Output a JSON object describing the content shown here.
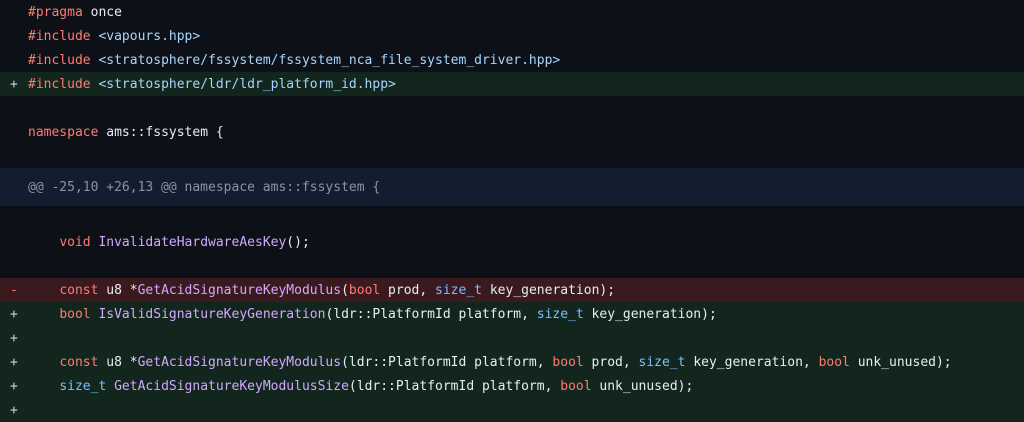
{
  "diff": {
    "lines": [
      {
        "kind": "ctx",
        "marker": "",
        "tokens": [
          {
            "t": "#pragma",
            "c": "kw"
          },
          {
            "t": " once",
            "c": "plain"
          }
        ]
      },
      {
        "kind": "ctx",
        "marker": "",
        "tokens": [
          {
            "t": "#include",
            "c": "kw"
          },
          {
            "t": " ",
            "c": "plain"
          },
          {
            "t": "<vapours.hpp>",
            "c": "str"
          }
        ]
      },
      {
        "kind": "ctx",
        "marker": "",
        "tokens": [
          {
            "t": "#include",
            "c": "kw"
          },
          {
            "t": " ",
            "c": "plain"
          },
          {
            "t": "<stratosphere/fssystem/fssystem_nca_file_system_driver.hpp>",
            "c": "str"
          }
        ]
      },
      {
        "kind": "add",
        "marker": "+",
        "tokens": [
          {
            "t": "#include",
            "c": "kw"
          },
          {
            "t": " ",
            "c": "plain"
          },
          {
            "t": "<stratosphere/ldr/ldr_platform_id.hpp>",
            "c": "str"
          }
        ]
      },
      {
        "kind": "ctx",
        "marker": "",
        "tokens": []
      },
      {
        "kind": "ctx",
        "marker": "",
        "tokens": [
          {
            "t": "namespace",
            "c": "kw"
          },
          {
            "t": " ams::fssystem {",
            "c": "plain"
          }
        ]
      },
      {
        "kind": "ctx",
        "marker": "",
        "tokens": []
      },
      {
        "kind": "hunk",
        "marker": "",
        "tokens": [
          {
            "t": "@@ -25,10 +26,13 @@ namespace ams::fssystem {",
            "c": "hunk"
          }
        ]
      },
      {
        "kind": "ctx",
        "marker": "",
        "tokens": []
      },
      {
        "kind": "ctx",
        "marker": "",
        "tokens": [
          {
            "t": "    ",
            "c": "plain"
          },
          {
            "t": "void",
            "c": "kw"
          },
          {
            "t": " ",
            "c": "plain"
          },
          {
            "t": "InvalidateHardwareAesKey",
            "c": "fn"
          },
          {
            "t": "();",
            "c": "plain"
          }
        ]
      },
      {
        "kind": "ctx",
        "marker": "",
        "tokens": []
      },
      {
        "kind": "del",
        "marker": "-",
        "tokens": [
          {
            "t": "    ",
            "c": "plain"
          },
          {
            "t": "const",
            "c": "kw"
          },
          {
            "t": " u8 *",
            "c": "plain"
          },
          {
            "t": "GetAcidSignatureKeyModulus",
            "c": "fn"
          },
          {
            "t": "(",
            "c": "plain"
          },
          {
            "t": "bool",
            "c": "kw"
          },
          {
            "t": " prod, ",
            "c": "plain"
          },
          {
            "t": "size_t",
            "c": "type"
          },
          {
            "t": " key_generation);",
            "c": "plain"
          }
        ]
      },
      {
        "kind": "add",
        "marker": "+",
        "tokens": [
          {
            "t": "    ",
            "c": "plain"
          },
          {
            "t": "bool",
            "c": "kw"
          },
          {
            "t": " ",
            "c": "plain"
          },
          {
            "t": "IsValidSignatureKeyGeneration",
            "c": "fn"
          },
          {
            "t": "(ldr::PlatformId platform, ",
            "c": "plain"
          },
          {
            "t": "size_t",
            "c": "type"
          },
          {
            "t": " key_generation);",
            "c": "plain"
          }
        ]
      },
      {
        "kind": "add",
        "marker": "+",
        "tokens": []
      },
      {
        "kind": "add",
        "marker": "+",
        "tokens": [
          {
            "t": "    ",
            "c": "plain"
          },
          {
            "t": "const",
            "c": "kw"
          },
          {
            "t": " u8 *",
            "c": "plain"
          },
          {
            "t": "GetAcidSignatureKeyModulus",
            "c": "fn"
          },
          {
            "t": "(ldr::PlatformId platform, ",
            "c": "plain"
          },
          {
            "t": "bool",
            "c": "kw"
          },
          {
            "t": " prod, ",
            "c": "plain"
          },
          {
            "t": "size_t",
            "c": "type"
          },
          {
            "t": " key_generation, ",
            "c": "plain"
          },
          {
            "t": "bool",
            "c": "kw"
          },
          {
            "t": " unk_unused);",
            "c": "plain"
          }
        ]
      },
      {
        "kind": "add",
        "marker": "+",
        "tokens": [
          {
            "t": "    ",
            "c": "plain"
          },
          {
            "t": "size_t",
            "c": "type"
          },
          {
            "t": " ",
            "c": "plain"
          },
          {
            "t": "GetAcidSignatureKeyModulusSize",
            "c": "fn"
          },
          {
            "t": "(ldr::PlatformId platform, ",
            "c": "plain"
          },
          {
            "t": "bool",
            "c": "kw"
          },
          {
            "t": " unk_unused);",
            "c": "plain"
          }
        ]
      },
      {
        "kind": "add",
        "marker": "+",
        "tokens": []
      }
    ]
  }
}
